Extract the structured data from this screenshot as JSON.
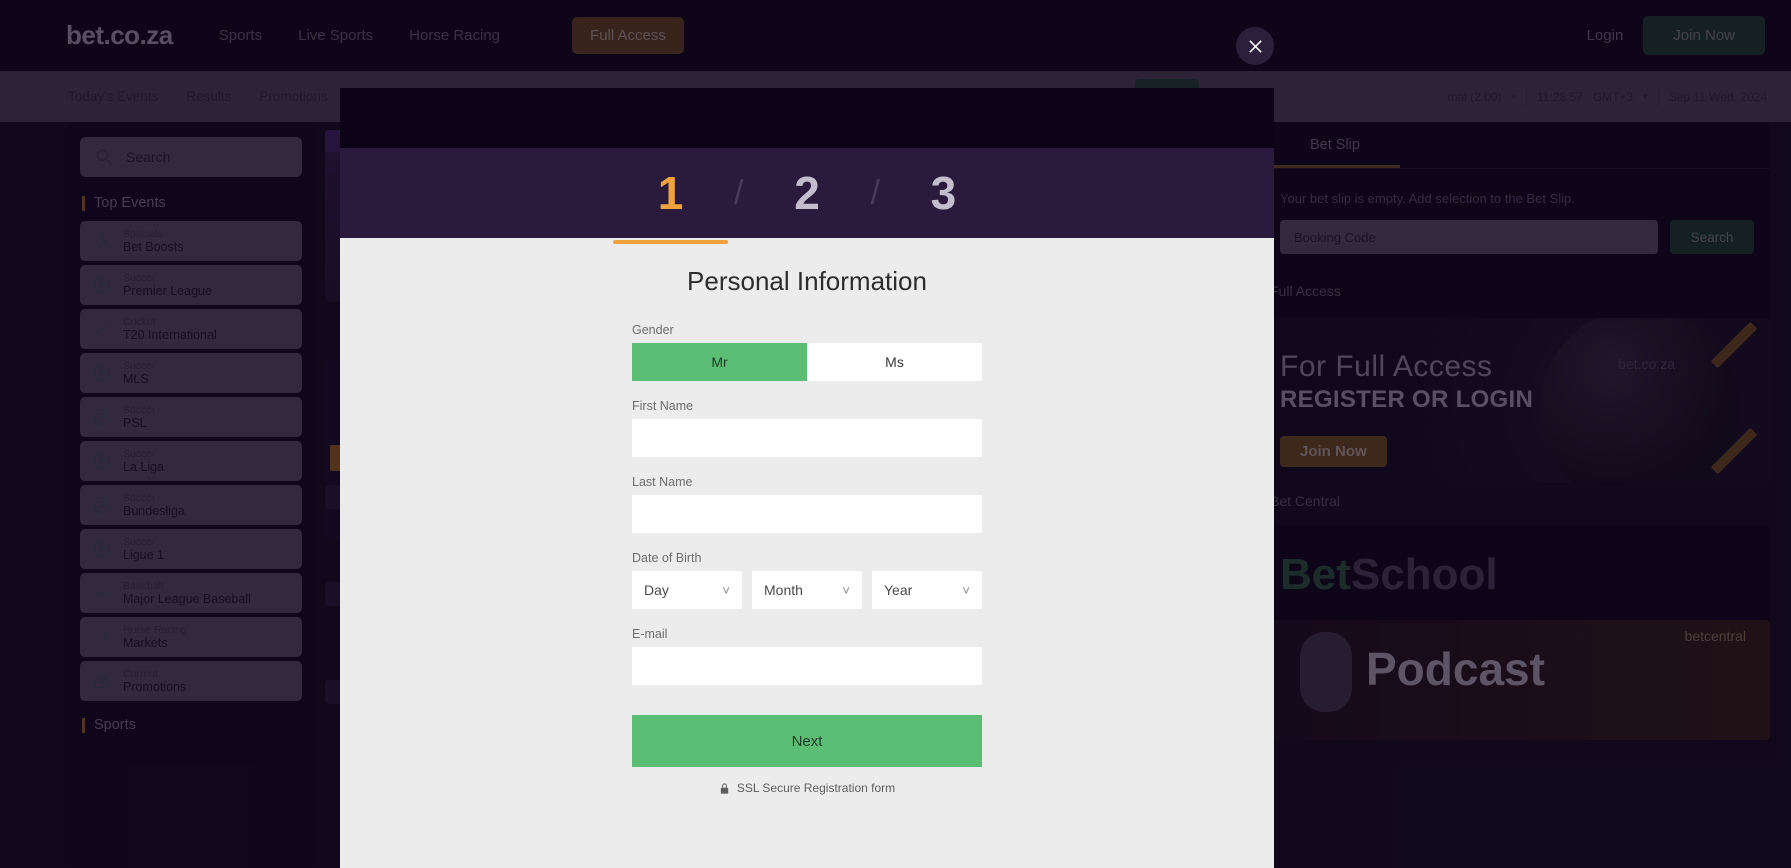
{
  "site": {
    "brand": "bet.co.za",
    "nav": [
      {
        "label": "Sports"
      },
      {
        "label": "Live Sports"
      },
      {
        "label": "Horse Racing"
      }
    ],
    "full_access_button": "Full Access",
    "login_label": "Login",
    "join_now_label": "Join Now",
    "subnav": [
      {
        "label": "Today's Events"
      },
      {
        "label": "Results"
      },
      {
        "label": "Promotions"
      }
    ],
    "odds_format": "mal (2.00)",
    "clock": "11:28:57",
    "timezone": "GMT+3",
    "date": "Sep 11 Wed, 2024"
  },
  "sidebar": {
    "search_placeholder": "Search",
    "section_top_events": "Top Events",
    "section_sports": "Sports",
    "items": [
      {
        "category": "Specials",
        "name": "Bet Boosts",
        "icon": "bolt-icon"
      },
      {
        "category": "Soccer",
        "name": "Premier League",
        "icon": "soccer-icon"
      },
      {
        "category": "Cricket",
        "name": "T20 International",
        "icon": "cricket-icon"
      },
      {
        "category": "Soccer",
        "name": "MLS",
        "icon": "soccer-icon"
      },
      {
        "category": "Soccer",
        "name": "PSL",
        "icon": "soccer-icon"
      },
      {
        "category": "Soccer",
        "name": "La Liga",
        "icon": "soccer-icon"
      },
      {
        "category": "Soccer",
        "name": "Bundesliga",
        "icon": "soccer-icon"
      },
      {
        "category": "Soccer",
        "name": "Ligue 1",
        "icon": "soccer-icon"
      },
      {
        "category": "Baseball",
        "name": "Major League Baseball",
        "icon": "baseball-icon"
      },
      {
        "category": "Horse Racing",
        "name": "Markets",
        "icon": "horse-icon"
      },
      {
        "category": "Current",
        "name": "Promotions",
        "icon": "gift-icon"
      }
    ]
  },
  "right_panel": {
    "bet_slip_tab": "Bet Slip",
    "empty_message": "Your bet slip is empty. Add selection to the Bet Slip.",
    "booking_code_placeholder": "Booking Code",
    "search_button": "Search",
    "full_access_title": "Full Access",
    "banner_line1": "For Full Access",
    "banner_line2": "REGISTER OR LOGIN",
    "banner_button": "Join Now",
    "banner_logo": "bet.co.za",
    "bet_central_title": "Bet Central",
    "bet_school_a": "Bet",
    "bet_school_b": "School",
    "podcast_text": "Podcast",
    "podcast_brand": "betcentral"
  },
  "modal": {
    "close_icon": "close-icon",
    "steps": [
      {
        "number": "1",
        "active": true
      },
      {
        "number": "2",
        "active": false
      },
      {
        "number": "3",
        "active": false
      }
    ],
    "step_separator": "/",
    "title": "Personal Information",
    "gender": {
      "label": "Gender",
      "options": [
        {
          "label": "Mr",
          "selected": true
        },
        {
          "label": "Ms",
          "selected": false
        }
      ]
    },
    "first_name": {
      "label": "First Name",
      "value": "",
      "placeholder": ""
    },
    "last_name": {
      "label": "Last Name",
      "value": "",
      "placeholder": ""
    },
    "date_of_birth": {
      "label": "Date of Birth",
      "day": "Day",
      "month": "Month",
      "year": "Year"
    },
    "email": {
      "label": "E-mail",
      "value": "",
      "placeholder": ""
    },
    "next_button": "Next",
    "ssl_note": "SSL Secure Registration form",
    "lock_icon": "lock-icon"
  },
  "colors": {
    "accent_orange": "#f0a33c",
    "accent_green": "#5cbe74",
    "modal_bg": "#ececec",
    "step_band": "#2a1b3d",
    "site_dark": "#0d0418"
  }
}
